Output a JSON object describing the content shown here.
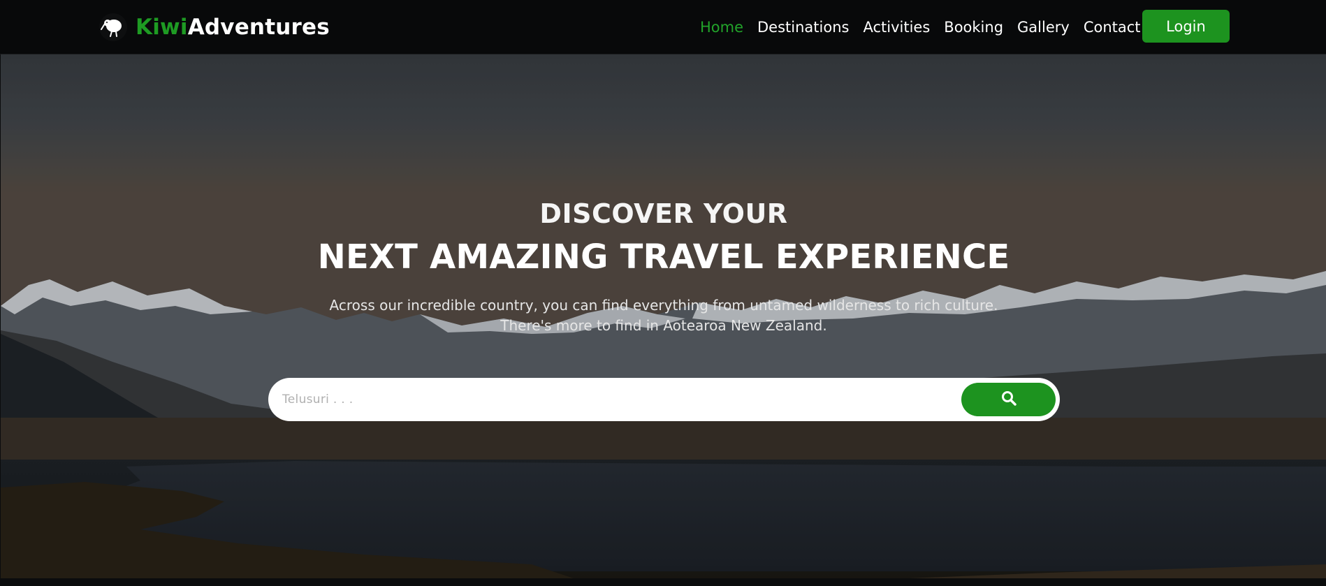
{
  "brand": {
    "name_part1": "Kiwi",
    "name_part2": "Adventures",
    "logo_icon": "kiwi-bird-icon"
  },
  "nav": {
    "links": [
      {
        "label": "Home",
        "active": true
      },
      {
        "label": "Destinations",
        "active": false
      },
      {
        "label": "Activities",
        "active": false
      },
      {
        "label": "Booking",
        "active": false
      },
      {
        "label": "Gallery",
        "active": false
      },
      {
        "label": "Contact",
        "active": false
      }
    ],
    "login_label": "Login"
  },
  "hero": {
    "subtitle": "DISCOVER YOUR",
    "title": "NEXT AMAZING TRAVEL EXPERIENCE",
    "text_line1": "Across our incredible country, you can find everything from untamed wilderness to rich culture.",
    "text_line2": "There's more to find in Aotearoa New Zealand."
  },
  "search": {
    "placeholder": "Telusuri . . .",
    "button_icon": "search-icon"
  },
  "colors": {
    "accent": "#1d931f",
    "nav_bg": "#08090a",
    "active_link": "#22a32a"
  }
}
